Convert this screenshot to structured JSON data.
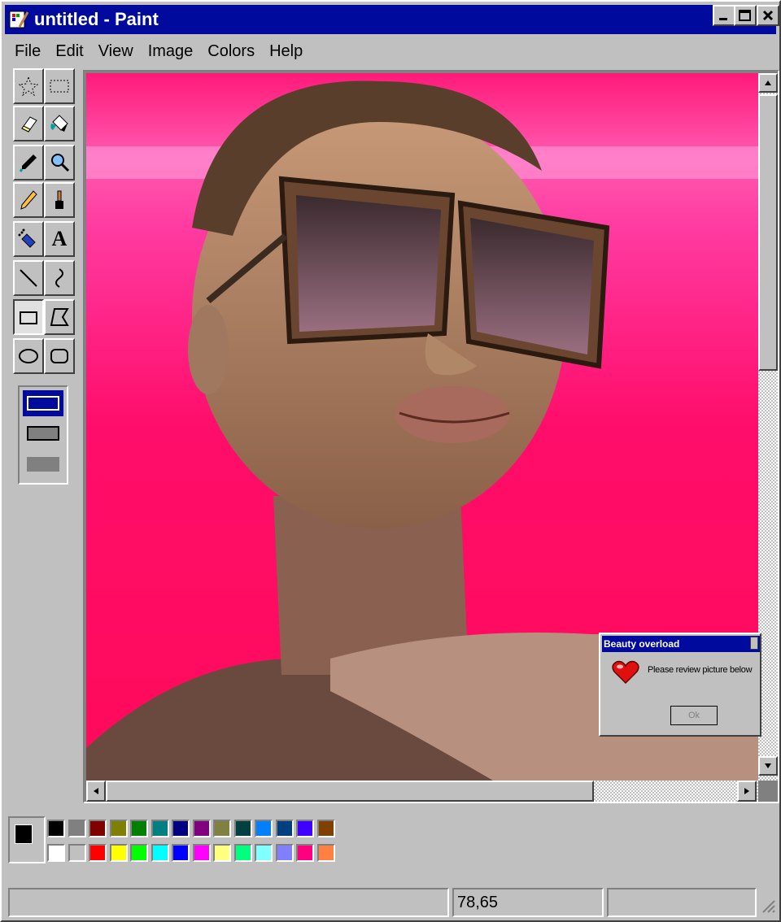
{
  "window": {
    "title": "untitled - Paint"
  },
  "title_buttons": {
    "minimize": "_",
    "maximize": "□",
    "close": "✕"
  },
  "menu": [
    "File",
    "Edit",
    "View",
    "Image",
    "Colors",
    "Help"
  ],
  "tools": [
    {
      "name": "free-form-select",
      "icon": "free-select-icon"
    },
    {
      "name": "select",
      "icon": "rect-select-icon"
    },
    {
      "name": "eraser",
      "icon": "eraser-icon"
    },
    {
      "name": "fill",
      "icon": "paint-bucket-icon"
    },
    {
      "name": "pick-color",
      "icon": "eyedropper-icon"
    },
    {
      "name": "magnifier",
      "icon": "magnifier-icon"
    },
    {
      "name": "pencil",
      "icon": "pencil-icon"
    },
    {
      "name": "brush",
      "icon": "brush-icon"
    },
    {
      "name": "airbrush",
      "icon": "airbrush-icon"
    },
    {
      "name": "text",
      "icon": "text-icon",
      "glyph": "A"
    },
    {
      "name": "line",
      "icon": "line-icon"
    },
    {
      "name": "curve",
      "icon": "curve-icon"
    },
    {
      "name": "rectangle",
      "icon": "rectangle-icon",
      "active": true
    },
    {
      "name": "polygon",
      "icon": "polygon-icon"
    },
    {
      "name": "ellipse",
      "icon": "ellipse-icon"
    },
    {
      "name": "rounded-rectangle",
      "icon": "rounded-rect-icon"
    }
  ],
  "palette": {
    "foreground": "#000000",
    "background": "#ffffff",
    "row1": [
      "#000000",
      "#808080",
      "#800000",
      "#808000",
      "#008000",
      "#008080",
      "#000080",
      "#800080",
      "#808040",
      "#004040",
      "#0080ff",
      "#004080",
      "#4000ff",
      "#804000"
    ],
    "row2": [
      "#ffffff",
      "#c0c0c0",
      "#ff0000",
      "#ffff00",
      "#00ff00",
      "#00ffff",
      "#0000ff",
      "#ff00ff",
      "#ffff80",
      "#00ff80",
      "#80ffff",
      "#8080ff",
      "#ff0080",
      "#ff8040"
    ]
  },
  "status": {
    "help_text": "",
    "coords": "78,65",
    "size": ""
  },
  "dialog": {
    "title": "Beauty overload",
    "message": "Please review picture below",
    "ok_label": "Ok",
    "icon": "heart-icon"
  },
  "canvas": {
    "content": "photo-image",
    "background": "#ff0f7a"
  }
}
